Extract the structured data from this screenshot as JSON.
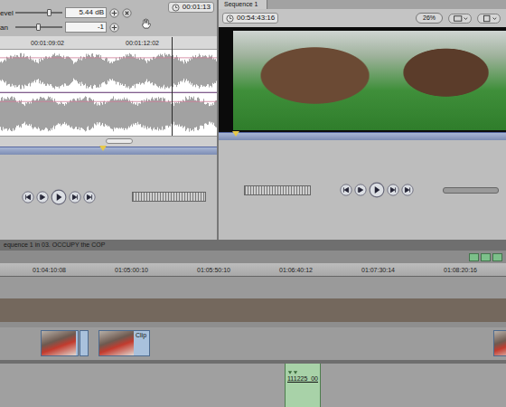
{
  "viewer": {
    "timecode": "00:01:13",
    "controls": [
      {
        "label": "evel",
        "reading": "5.44 dB",
        "level": 0.72
      },
      {
        "label": "an",
        "reading": "-1",
        "level": 0.48
      }
    ],
    "ruler": [
      "00:01:09:02",
      "00:01:12:02"
    ],
    "audio_channels": 2,
    "playhead": 0.79,
    "scroll": 0.55
  },
  "canvas": {
    "title": "Sequence 1",
    "timecode": "00:54:43:16",
    "zoom": "26%",
    "playhead": 0.06
  },
  "timeline": {
    "tab": "equence 1 in 03. OCCUPY the COP",
    "ruler": [
      "01:04:10:08",
      "01:05:00:10",
      "01:05:50:10",
      "01:06:40:12",
      "01:07:30:14",
      "01:08:20:16"
    ],
    "video_clips": [
      {
        "kind": "thumb",
        "label": ""
      },
      {
        "kind": "sliver",
        "label": ""
      },
      {
        "kind": "labeled",
        "label": "Clip"
      },
      {
        "kind": "thumb",
        "label": ""
      }
    ],
    "audio_clips": [
      {
        "label": "111225_00"
      }
    ]
  }
}
